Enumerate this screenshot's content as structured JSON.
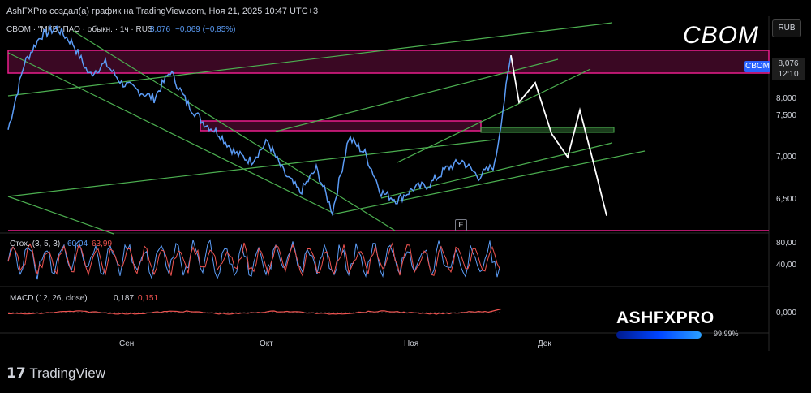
{
  "header": {
    "title": "AshFXPro создал(а) график на TradingView.com, Ноя 21, 2025 10:47 UTC+3"
  },
  "legend": {
    "symbol_info": "CBOM · \"МКБ\" ПАО · обыкн. · 1ч · RUS",
    "price": "8,076",
    "change": "−0,069 (−0,85%)"
  },
  "watermark": "CBOM",
  "currency_button": "RUB",
  "price_tag": {
    "symbol": "CBOM",
    "price": "8,076",
    "time": "12:10"
  },
  "event_marker": "E",
  "stoch": {
    "label": "Стох. (3, 5, 3)",
    "k": "60,04",
    "d": "63,99"
  },
  "macd": {
    "label": "MACD (12, 26, close)",
    "v1": "0,187",
    "v2": "0,151"
  },
  "logo": {
    "name": "ASHFXPRO",
    "percent": "99.99%"
  },
  "tradingview_logo": "TradingView",
  "colors": {
    "price_line": "#5b9cf6",
    "trendline": "#4caf50",
    "zone": "#e91e8c",
    "projection": "#ffffff",
    "stoch_k": "#5b9cf6",
    "stoch_d": "#ef5350"
  },
  "chart_data": {
    "type": "line",
    "price_axis": [
      "8,000",
      "7,500",
      "7,000",
      "6,500"
    ],
    "stoch_axis": [
      "80,00",
      "40,00"
    ],
    "macd_axis": [
      "0,000"
    ],
    "x_labels": [
      "Сен",
      "Окт",
      "Ноя",
      "Дек"
    ],
    "ylim": [
      6.05,
      8.8
    ],
    "series": [
      {
        "x": [
          0,
          20,
          40,
          60,
          80,
          100,
          120,
          140,
          160,
          180,
          200,
          220,
          240,
          260,
          280,
          300,
          320,
          340,
          360,
          380,
          400,
          420,
          440,
          460,
          480,
          500,
          520,
          540,
          560,
          580,
          600,
          620
        ],
        "values": [
          7.35,
          8.2,
          8.55,
          8.65,
          8.45,
          8.05,
          8.2,
          7.95,
          7.85,
          7.75,
          8.1,
          7.7,
          7.45,
          7.3,
          7.05,
          6.95,
          7.2,
          6.8,
          6.55,
          6.85,
          6.3,
          7.25,
          7.05,
          6.55,
          6.45,
          6.6,
          6.65,
          6.85,
          6.95,
          6.75,
          6.9,
          8.3
        ]
      }
    ],
    "projection": [
      [
        620,
        8.3
      ],
      [
        630,
        7.7
      ],
      [
        650,
        7.95
      ],
      [
        670,
        7.3
      ],
      [
        690,
        7.0
      ],
      [
        705,
        7.6
      ],
      [
        720,
        7.0
      ],
      [
        738,
        6.25
      ]
    ]
  }
}
